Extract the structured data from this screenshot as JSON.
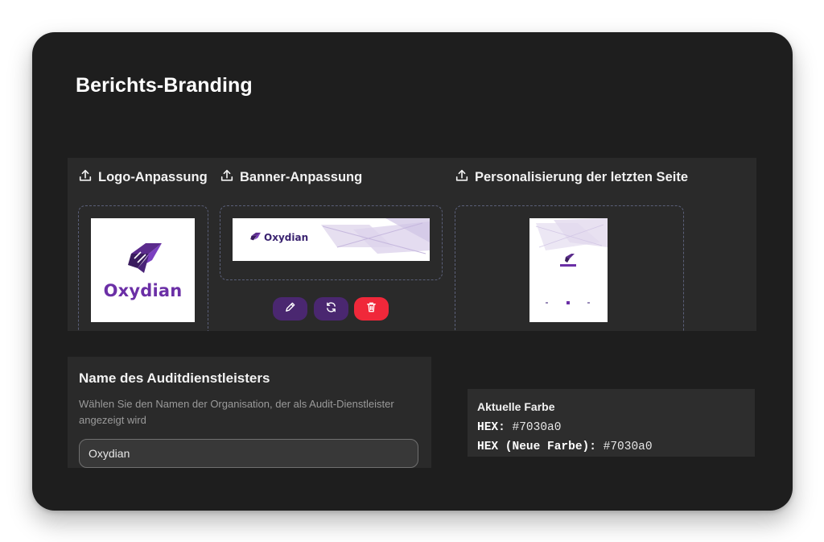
{
  "page": {
    "title": "Berichts-Branding"
  },
  "sections": {
    "logo": {
      "label": "Logo-Anpassung",
      "icon": "upload-icon"
    },
    "banner": {
      "label": "Banner-Anpassung",
      "icon": "upload-icon"
    },
    "last_page": {
      "label": "Personalisierung der letzten Seite",
      "icon": "upload-icon"
    }
  },
  "logo_preview": {
    "brand": "Oxydian",
    "brand_color": "#6b2fa6"
  },
  "banner_preview": {
    "brand": "Oxydian"
  },
  "banner_actions": {
    "edit_icon": "pencil-icon",
    "refresh_icon": "refresh-icon",
    "delete_icon": "trash-icon",
    "edit_color": "#4a2770",
    "delete_color": "#f0283a"
  },
  "auditor": {
    "title": "Name des Auditdienstleisters",
    "description": "Wählen Sie den Namen der Organisation, der als Audit-Dienstleister angezeigt wird",
    "value": "Oxydian"
  },
  "color": {
    "title": "Aktuelle Farbe",
    "hex_label": "HEX:",
    "hex_value": "#7030a0",
    "new_label": "HEX (Neue Farbe):",
    "new_value": "#7030a0"
  }
}
